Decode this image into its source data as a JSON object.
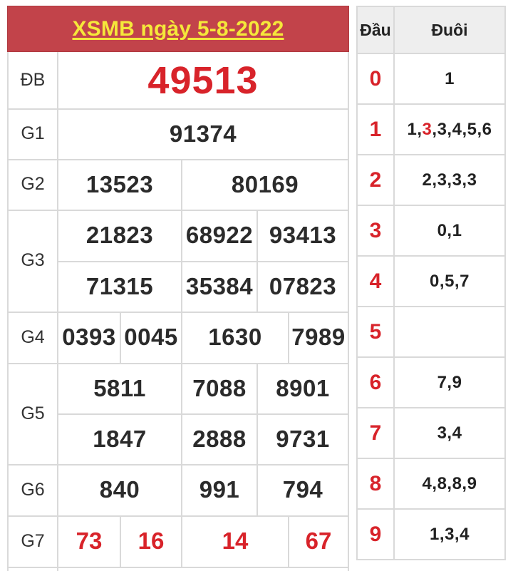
{
  "title": "XSMB ngày 5-8-2022",
  "labels": {
    "db": "ĐB",
    "g1": "G1",
    "g2": "G2",
    "g3": "G3",
    "g4": "G4",
    "g5": "G5",
    "g6": "G6",
    "g7": "G7"
  },
  "prizes": {
    "db": "49513",
    "g1": "91374",
    "g2": [
      "13523",
      "80169"
    ],
    "g3": [
      "21823",
      "68922",
      "93413",
      "71315",
      "35384",
      "07823"
    ],
    "g4": [
      "0393",
      "0045",
      "1630",
      "7989"
    ],
    "g5": [
      "5811",
      "7088",
      "8901",
      "1847",
      "2888",
      "9731"
    ],
    "g6": [
      "840",
      "991",
      "794"
    ],
    "g7": [
      "73",
      "16",
      "14",
      "67"
    ]
  },
  "loto": {
    "header_dau": "Đầu",
    "header_duoi": "Đuôi",
    "rows": [
      {
        "dau": "0",
        "duoi": "1"
      },
      {
        "dau": "1",
        "duoi_a": "1,",
        "duoi_red": "3",
        "duoi_b": ",3,4,5,6"
      },
      {
        "dau": "2",
        "duoi": "2,3,3,3"
      },
      {
        "dau": "3",
        "duoi": "0,1"
      },
      {
        "dau": "4",
        "duoi": "0,5,7"
      },
      {
        "dau": "5",
        "duoi": ""
      },
      {
        "dau": "6",
        "duoi": "7,9"
      },
      {
        "dau": "7",
        "duoi": "3,4"
      },
      {
        "dau": "8",
        "duoi": "4,8,8,9"
      },
      {
        "dau": "9",
        "duoi": "1,3,4"
      }
    ]
  },
  "colors": {
    "header_bg": "#c2434a",
    "title_text": "#f5e83a",
    "accent_red": "#d8232a",
    "grid_line": "#d9d9d9"
  }
}
